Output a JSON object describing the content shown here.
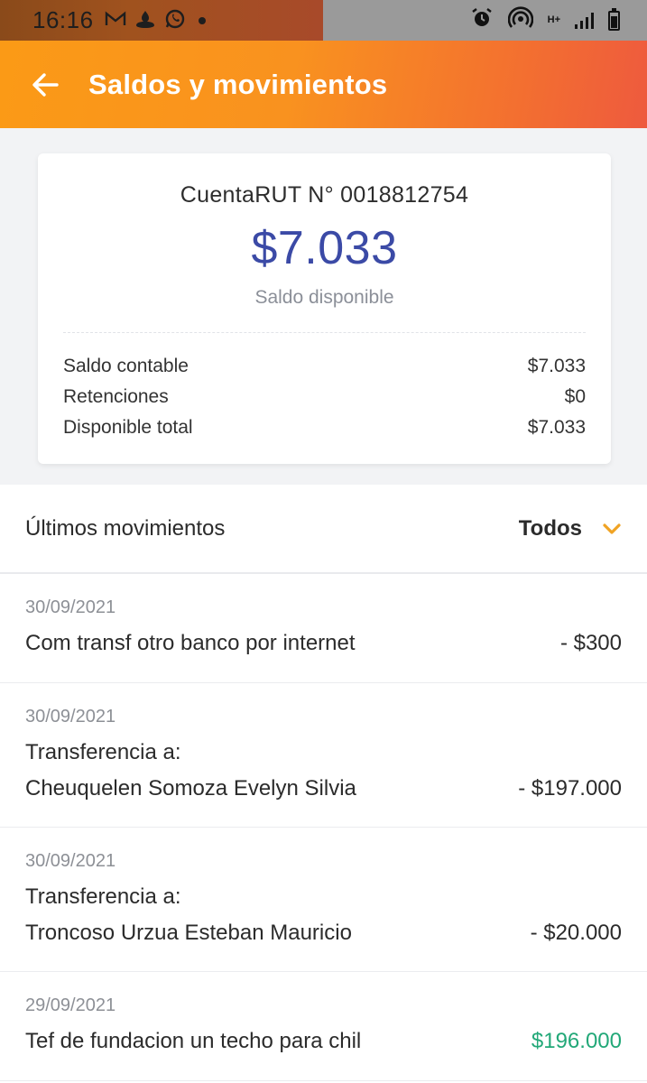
{
  "status_bar": {
    "time": "16:16",
    "left_icons": [
      "gmail-icon",
      "santander-icon",
      "whatsapp-icon"
    ],
    "right_icons": [
      "alarm-icon",
      "hotspot-icon",
      "network-type",
      "signal-icon",
      "battery-icon"
    ],
    "network_type": "H+"
  },
  "header": {
    "title": "Saldos y movimientos",
    "back_icon": "arrow-left-icon"
  },
  "balance_card": {
    "account": "CuentaRUT N° 0018812754",
    "balance": "$7.033",
    "balance_label": "Saldo disponible",
    "details": [
      {
        "label": "Saldo contable",
        "value": "$7.033"
      },
      {
        "label": "Retenciones",
        "value": "$0"
      },
      {
        "label": "Disponible total",
        "value": "$7.033"
      }
    ]
  },
  "movements": {
    "title": "Últimos movimientos",
    "filter_label": "Todos",
    "items": [
      {
        "date": "30/09/2021",
        "line1": "Com transf otro banco por internet",
        "line2": "",
        "amount": "- $300"
      },
      {
        "date": "30/09/2021",
        "line1": "Transferencia a:",
        "line2": "Cheuquelen Somoza Evelyn Silvia",
        "amount": "- $197.000"
      },
      {
        "date": "30/09/2021",
        "line1": "Transferencia a:",
        "line2": "Troncoso Urzua Esteban Mauricio",
        "amount": "- $20.000"
      },
      {
        "date": "29/09/2021",
        "line1": "Tef de fundacion un techo para chil",
        "line2": "",
        "amount": "$196.000"
      }
    ]
  },
  "colors": {
    "header_gradient_start": "#fb9a16",
    "header_gradient_end": "#ee5a3e",
    "balance_blue": "#3b4aa6",
    "positive_green": "#22a878",
    "chevron_orange": "#f0a323"
  }
}
